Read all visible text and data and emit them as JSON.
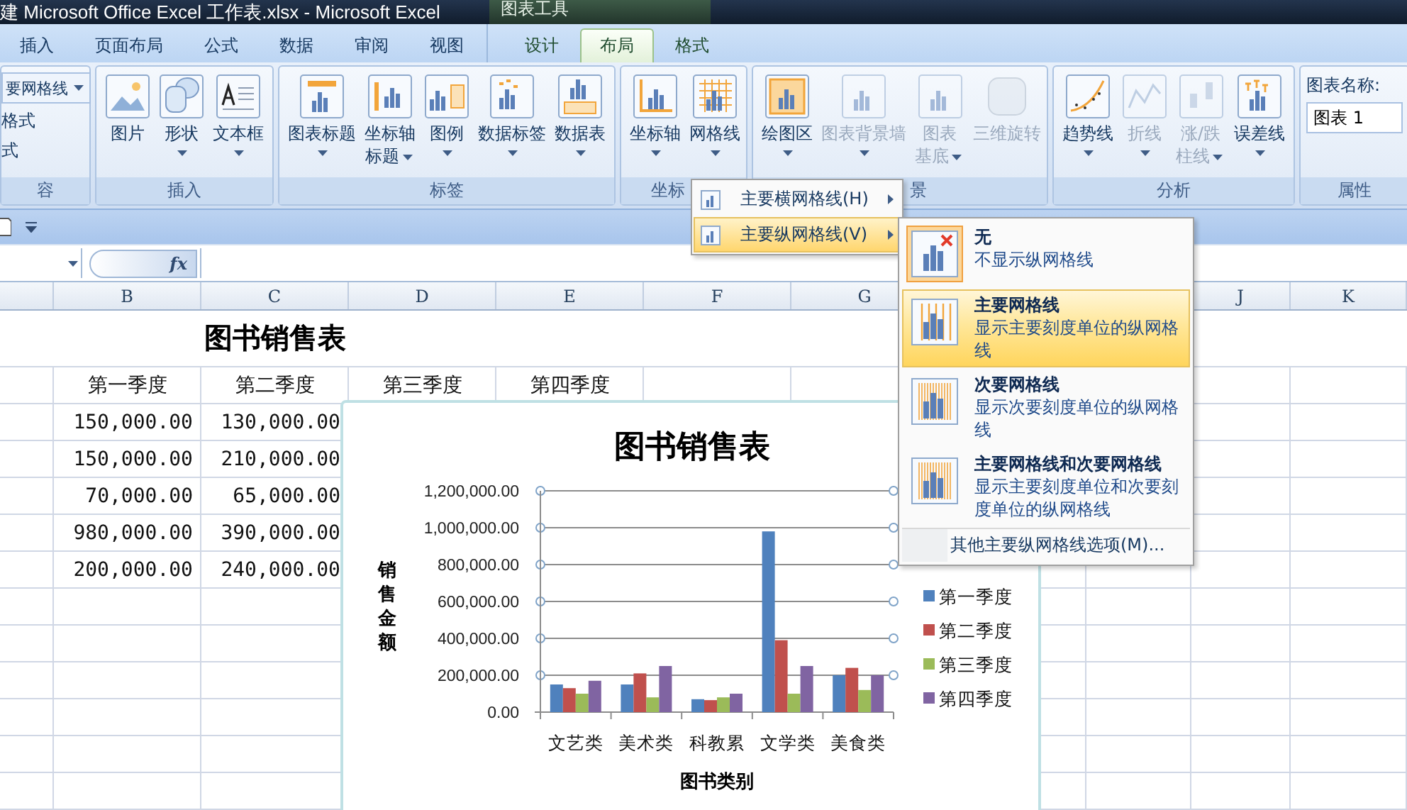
{
  "title_bar": {
    "title": "建 Microsoft Office Excel 工作表.xlsx - Microsoft Excel",
    "context_label": "图表工具"
  },
  "tabs": [
    {
      "label": "插入",
      "selected": false,
      "context": false
    },
    {
      "label": "页面布局",
      "selected": false,
      "context": false
    },
    {
      "label": "公式",
      "selected": false,
      "context": false
    },
    {
      "label": "数据",
      "selected": false,
      "context": false
    },
    {
      "label": "审阅",
      "selected": false,
      "context": false
    },
    {
      "label": "视图",
      "selected": false,
      "context": false
    },
    {
      "label": "设计",
      "selected": false,
      "context": true
    },
    {
      "label": "布局",
      "selected": true,
      "context": true
    },
    {
      "label": "格式",
      "selected": false,
      "context": true
    }
  ],
  "ribbon": {
    "groups": [
      {
        "kind": "list",
        "label": "容",
        "dropdown": "要网格线",
        "commands": [
          "格式",
          "式"
        ]
      },
      {
        "kind": "buttons",
        "label": "插入",
        "buttons": [
          {
            "lines": [
              "图片"
            ],
            "dropdown": false,
            "disabled": false
          },
          {
            "lines": [
              "形状"
            ],
            "dropdown": true,
            "disabled": false
          },
          {
            "lines": [
              "文本框"
            ],
            "dropdown": true,
            "disabled": false
          }
        ]
      },
      {
        "kind": "buttons",
        "label": "标签",
        "buttons": [
          {
            "lines": [
              "图表标题"
            ],
            "dropdown": true,
            "disabled": false
          },
          {
            "lines": [
              "坐标轴",
              "标题"
            ],
            "dropdown": true,
            "disabled": false
          },
          {
            "lines": [
              "图例"
            ],
            "dropdown": true,
            "disabled": false
          },
          {
            "lines": [
              "数据标签"
            ],
            "dropdown": true,
            "disabled": false
          },
          {
            "lines": [
              "数据表"
            ],
            "dropdown": true,
            "disabled": false
          }
        ]
      },
      {
        "kind": "buttons",
        "label": "坐标",
        "buttons": [
          {
            "lines": [
              "坐标轴"
            ],
            "dropdown": true,
            "disabled": false
          },
          {
            "lines": [
              "网格线"
            ],
            "dropdown": true,
            "disabled": false
          }
        ]
      },
      {
        "kind": "buttons",
        "label": "景",
        "buttons": [
          {
            "lines": [
              "绘图区"
            ],
            "dropdown": true,
            "disabled": false
          },
          {
            "lines": [
              "图表背景墙"
            ],
            "dropdown": true,
            "disabled": true
          },
          {
            "lines": [
              "图表",
              "基底"
            ],
            "dropdown": true,
            "disabled": true
          },
          {
            "lines": [
              "三维旋转"
            ],
            "dropdown": false,
            "disabled": true
          }
        ]
      },
      {
        "kind": "buttons",
        "label": "分析",
        "buttons": [
          {
            "lines": [
              "趋势线"
            ],
            "dropdown": true,
            "disabled": false
          },
          {
            "lines": [
              "折线"
            ],
            "dropdown": true,
            "disabled": true
          },
          {
            "lines": [
              "涨/跌",
              "柱线"
            ],
            "dropdown": true,
            "disabled": true
          },
          {
            "lines": [
              "误差线"
            ],
            "dropdown": true,
            "disabled": false
          }
        ]
      },
      {
        "kind": "name",
        "label": "属性",
        "field_label": "图表名称:",
        "value": "图表 1"
      }
    ]
  },
  "formula_bar": {
    "fx_label": "fx"
  },
  "sheet": {
    "columns": [
      {},
      {
        "letter": "B"
      },
      {
        "letter": "C"
      },
      {
        "letter": "D"
      },
      {
        "letter": "E"
      },
      {
        "letter": "F"
      },
      {
        "letter": "G"
      },
      {},
      {},
      {
        "letter": "J"
      },
      {
        "letter": "K"
      }
    ],
    "title": "图书销售表",
    "headers": [
      "第一季度",
      "第二季度",
      "第三季度",
      "第四季度"
    ],
    "rows": [
      [
        "",
        "150,000.00",
        "130,000.00"
      ],
      [
        "",
        "150,000.00",
        "210,000.00"
      ],
      [
        "",
        "70,000.00",
        "65,000.00"
      ],
      [
        "",
        "980,000.00",
        "390,000.00"
      ],
      [
        "",
        "200,000.00",
        "240,000.00"
      ]
    ]
  },
  "chart": {
    "chart_data": {
      "type": "bar",
      "title": "图书销售表",
      "xlabel": "图书类别",
      "ylabel": "销售金额",
      "categories": [
        "文艺类",
        "美术类",
        "科教累",
        "文学类",
        "美食类"
      ],
      "series": [
        {
          "name": "第一季度",
          "color": "#4f81bd",
          "values": [
            150000,
            150000,
            70000,
            980000,
            200000
          ]
        },
        {
          "name": "第二季度",
          "color": "#c0504d",
          "values": [
            130000,
            210000,
            65000,
            390000,
            240000
          ]
        },
        {
          "name": "第三季度",
          "color": "#9bbb59",
          "values": [
            100000,
            80000,
            80000,
            100000,
            120000
          ]
        },
        {
          "name": "第四季度",
          "color": "#8064a2",
          "values": [
            170000,
            250000,
            100000,
            250000,
            200000
          ]
        }
      ],
      "ylim": [
        0,
        1200000
      ],
      "grid": true,
      "legend": true,
      "yticks": [
        {
          "value": 0,
          "label": "0.00"
        },
        {
          "value": 200000,
          "label": "200,000.00"
        },
        {
          "value": 400000,
          "label": "400,000.00"
        },
        {
          "value": 600000,
          "label": "600,000.00"
        },
        {
          "value": 800000,
          "label": "800,000.00"
        },
        {
          "value": 1000000,
          "label": "1,000,000.00"
        },
        {
          "value": 1200000,
          "label": "1,200,000.00"
        }
      ]
    }
  },
  "gridline_menu": {
    "items": [
      {
        "label": "主要横网格线(H)",
        "selected": false
      },
      {
        "label": "主要纵网格线(V)",
        "selected": true
      }
    ]
  },
  "submenu": {
    "options": [
      {
        "kind": "none",
        "title": "无",
        "description": "不显示纵网格线",
        "current": true,
        "selected": false
      },
      {
        "kind": "major",
        "title": "主要网格线",
        "description": "显示主要刻度单位的纵网格线",
        "current": false,
        "selected": true
      },
      {
        "kind": "minor",
        "title": "次要网格线",
        "description": "显示次要刻度单位的纵网格线",
        "current": false,
        "selected": false
      },
      {
        "kind": "both",
        "title": "主要网格线和次要网格线",
        "description": "显示主要刻度单位和次要刻度单位的纵网格线",
        "current": false,
        "selected": false
      }
    ],
    "footer": "其他主要纵网格线选项(M)..."
  }
}
